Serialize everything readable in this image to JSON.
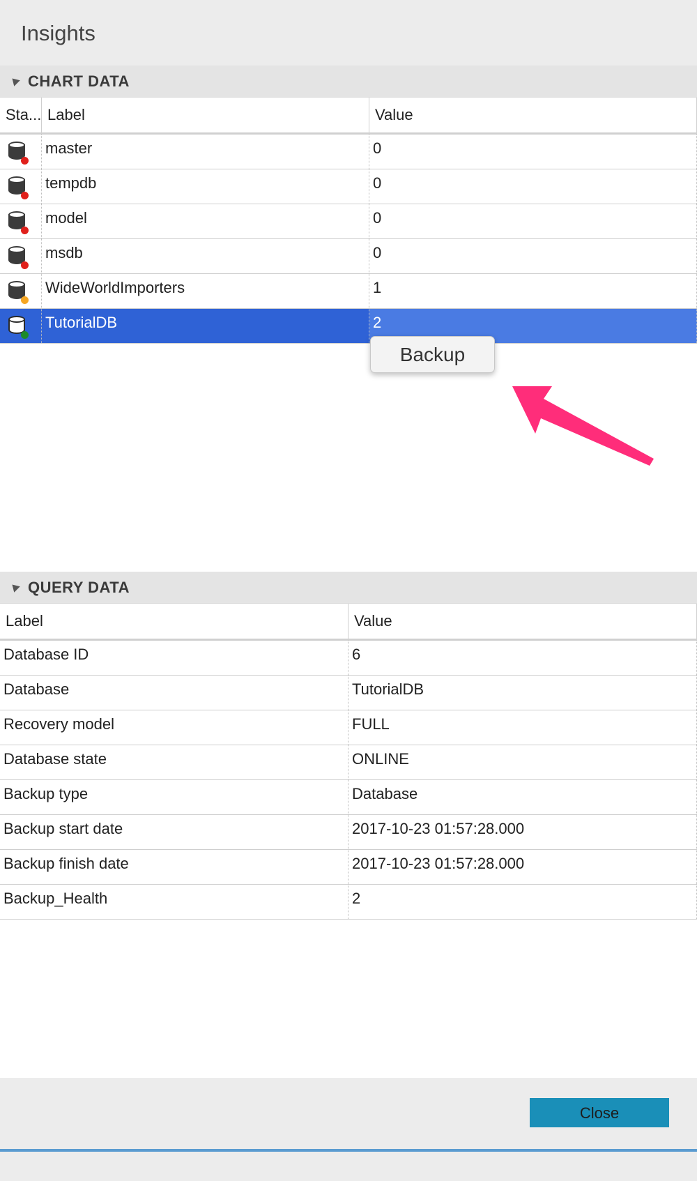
{
  "dialog": {
    "title": "Insights"
  },
  "chart_section": {
    "header": "CHART DATA",
    "columns": [
      "Sta...",
      "Label",
      "Value"
    ],
    "rows": [
      {
        "label": "master",
        "value": "0",
        "status_color": "#e0201b"
      },
      {
        "label": "tempdb",
        "value": "0",
        "status_color": "#e0201b"
      },
      {
        "label": "model",
        "value": "0",
        "status_color": "#e0201b"
      },
      {
        "label": "msdb",
        "value": "0",
        "status_color": "#e0201b"
      },
      {
        "label": "WideWorldImporters",
        "value": "1",
        "status_color": "#f5a623"
      },
      {
        "label": "TutorialDB",
        "value": "2",
        "status_color": "#1d8a2a"
      }
    ],
    "selected_row": "TutorialDB"
  },
  "context_menu": {
    "item": "Backup"
  },
  "annotation": {
    "arrow_color": "#ff2d7a"
  },
  "query_section": {
    "header": "QUERY DATA",
    "columns": [
      "Label",
      "Value"
    ],
    "rows": [
      {
        "label": "Database ID",
        "value": "6"
      },
      {
        "label": "Database",
        "value": "TutorialDB"
      },
      {
        "label": "Recovery model",
        "value": "FULL"
      },
      {
        "label": "Database state",
        "value": "ONLINE"
      },
      {
        "label": "Backup type",
        "value": "Database"
      },
      {
        "label": "Backup start date",
        "value": "2017-10-23 01:57:28.000"
      },
      {
        "label": "Backup finish date",
        "value": "2017-10-23 01:57:28.000"
      },
      {
        "label": "Backup_Health",
        "value": "2"
      }
    ]
  },
  "footer": {
    "close_label": "Close"
  },
  "colors": {
    "selection": "#2f62d6",
    "close_button": "#1a8fb8"
  }
}
